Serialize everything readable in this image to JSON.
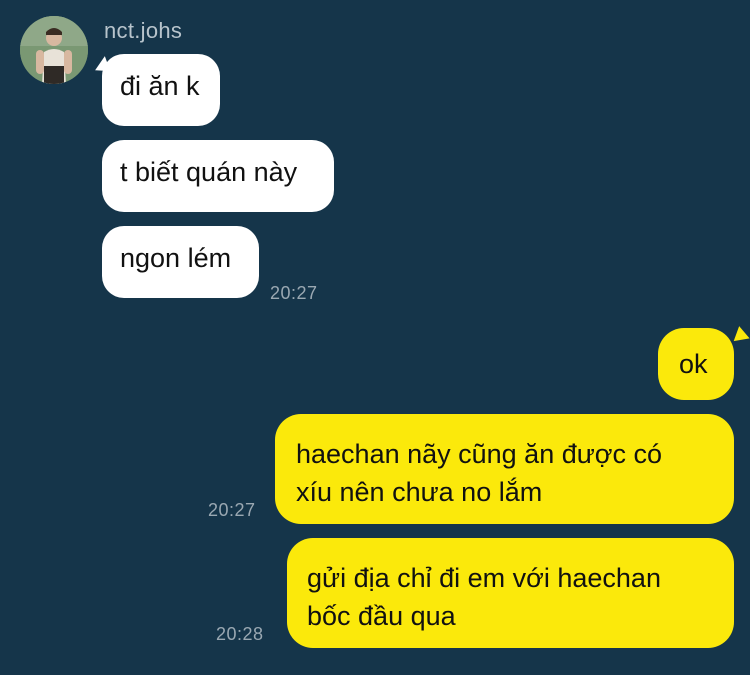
{
  "contact": {
    "name": "nct.johs",
    "avatar_icon": "person-photo-avatar"
  },
  "messages": [
    {
      "side": "incoming",
      "text": "đi ăn k"
    },
    {
      "side": "incoming",
      "text": "t biết quán này"
    },
    {
      "side": "incoming",
      "text": "ngon lém",
      "time": "20:27"
    },
    {
      "side": "outgoing",
      "text": "ok"
    },
    {
      "side": "outgoing",
      "lines": [
        "haechan nãy cũng ăn được có",
        "xíu nên chưa no lắm"
      ],
      "time": "20:27"
    },
    {
      "side": "outgoing",
      "lines": [
        "gửi địa chỉ đi em với haechan",
        "bốc đầu qua"
      ],
      "time": "20:28"
    }
  ],
  "colors": {
    "background": "#15354a",
    "incoming_bubble": "#ffffff",
    "outgoing_bubble": "#fbe90b",
    "timestamp": "#9aa8b2"
  }
}
